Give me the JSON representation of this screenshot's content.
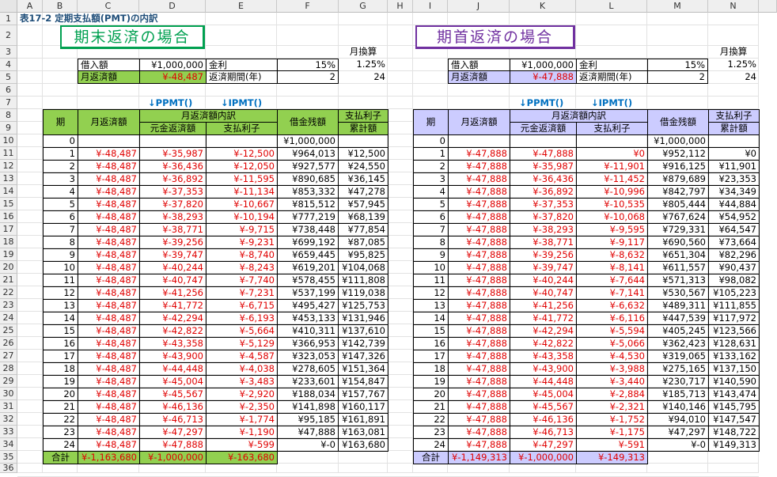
{
  "columns": [
    "A",
    "B",
    "C",
    "D",
    "E",
    "F",
    "G",
    "H",
    "I",
    "J",
    "K",
    "L",
    "M",
    "N"
  ],
  "rows": [
    "1",
    "2",
    "3",
    "4",
    "5",
    "6",
    "7",
    "8",
    "9",
    "10",
    "11",
    "12",
    "13",
    "14",
    "15",
    "16",
    "17",
    "18",
    "19",
    "20",
    "21",
    "22",
    "23",
    "24",
    "25",
    "26",
    "27",
    "28",
    "29",
    "30",
    "31",
    "32",
    "33",
    "34",
    "35",
    "36"
  ],
  "sheet_title": "表17-2 定期支払額(PMT)の内訳",
  "colors": {
    "green_header": "#92d050",
    "purple_header": "#ccccff",
    "negative": "#e00000",
    "arrow": "#0070c0"
  },
  "left": {
    "banner": "期末返済の場合",
    "monthly_label": "月換算",
    "loan_label": "借入額",
    "loan_value": "¥1,000,000",
    "rate_label": "金利",
    "rate_value": "15%",
    "rate_monthly": "1.25%",
    "payment_label": "月返済額",
    "payment_value": "¥-48,487",
    "period_label": "返済期間(年)",
    "period_value": "2",
    "period_months": "24",
    "ppmt_label": "↓PPMT()",
    "ipmt_label": "↓IPMT()",
    "headers": {
      "period": "期",
      "payment": "月返済額",
      "breakdown": "月返済額内訳",
      "principal": "元金返済額",
      "interest": "支払利子",
      "balance": "借金残額",
      "cum_interest_1": "支払利子",
      "cum_interest_2": "累計額"
    },
    "rows": [
      [
        "0",
        "",
        "",
        "",
        "¥1,000,000",
        ""
      ],
      [
        "1",
        "¥-48,487",
        "¥-35,987",
        "¥-12,500",
        "¥964,013",
        "¥12,500"
      ],
      [
        "2",
        "¥-48,487",
        "¥-36,436",
        "¥-12,050",
        "¥927,577",
        "¥24,550"
      ],
      [
        "3",
        "¥-48,487",
        "¥-36,892",
        "¥-11,595",
        "¥890,685",
        "¥36,145"
      ],
      [
        "4",
        "¥-48,487",
        "¥-37,353",
        "¥-11,134",
        "¥853,332",
        "¥47,278"
      ],
      [
        "5",
        "¥-48,487",
        "¥-37,820",
        "¥-10,667",
        "¥815,512",
        "¥57,945"
      ],
      [
        "6",
        "¥-48,487",
        "¥-38,293",
        "¥-10,194",
        "¥777,219",
        "¥68,139"
      ],
      [
        "7",
        "¥-48,487",
        "¥-38,771",
        "¥-9,715",
        "¥738,448",
        "¥77,854"
      ],
      [
        "8",
        "¥-48,487",
        "¥-39,256",
        "¥-9,231",
        "¥699,192",
        "¥87,085"
      ],
      [
        "9",
        "¥-48,487",
        "¥-39,747",
        "¥-8,740",
        "¥659,445",
        "¥95,825"
      ],
      [
        "10",
        "¥-48,487",
        "¥-40,244",
        "¥-8,243",
        "¥619,201",
        "¥104,068"
      ],
      [
        "11",
        "¥-48,487",
        "¥-40,747",
        "¥-7,740",
        "¥578,455",
        "¥111,808"
      ],
      [
        "12",
        "¥-48,487",
        "¥-41,256",
        "¥-7,231",
        "¥537,199",
        "¥119,038"
      ],
      [
        "13",
        "¥-48,487",
        "¥-41,772",
        "¥-6,715",
        "¥495,427",
        "¥125,753"
      ],
      [
        "14",
        "¥-48,487",
        "¥-42,294",
        "¥-6,193",
        "¥453,133",
        "¥131,946"
      ],
      [
        "15",
        "¥-48,487",
        "¥-42,822",
        "¥-5,664",
        "¥410,311",
        "¥137,610"
      ],
      [
        "16",
        "¥-48,487",
        "¥-43,358",
        "¥-5,129",
        "¥366,953",
        "¥142,739"
      ],
      [
        "17",
        "¥-48,487",
        "¥-43,900",
        "¥-4,587",
        "¥323,053",
        "¥147,326"
      ],
      [
        "18",
        "¥-48,487",
        "¥-44,448",
        "¥-4,038",
        "¥278,605",
        "¥151,364"
      ],
      [
        "19",
        "¥-48,487",
        "¥-45,004",
        "¥-3,483",
        "¥233,601",
        "¥154,847"
      ],
      [
        "20",
        "¥-48,487",
        "¥-45,567",
        "¥-2,920",
        "¥188,034",
        "¥157,767"
      ],
      [
        "21",
        "¥-48,487",
        "¥-46,136",
        "¥-2,350",
        "¥141,898",
        "¥160,117"
      ],
      [
        "22",
        "¥-48,487",
        "¥-46,713",
        "¥-1,774",
        "¥95,185",
        "¥161,891"
      ],
      [
        "23",
        "¥-48,487",
        "¥-47,297",
        "¥-1,190",
        "¥47,888",
        "¥163,081"
      ],
      [
        "24",
        "¥-48,487",
        "¥-47,888",
        "¥-599",
        "¥-0",
        "¥163,680"
      ]
    ],
    "total_label": "合計",
    "total_payment": "¥-1,163,680",
    "total_principal": "¥-1,000,000",
    "total_interest": "¥-163,680"
  },
  "right": {
    "banner": "期首返済の場合",
    "monthly_label": "月換算",
    "loan_label": "借入額",
    "loan_value": "¥1,000,000",
    "rate_label": "金利",
    "rate_value": "15%",
    "rate_monthly": "1.25%",
    "payment_label": "月返済額",
    "payment_value": "¥-47,888",
    "period_label": "返済期間(年)",
    "period_value": "2",
    "period_months": "24",
    "ppmt_label": "↓PPMT()",
    "ipmt_label": "↓IPMT()",
    "headers": {
      "period": "期",
      "payment": "月返済額",
      "breakdown": "月返済額内訳",
      "principal": "元金返済額",
      "interest": "支払利子",
      "balance": "借金残額",
      "cum_interest_1": "支払利子",
      "cum_interest_2": "累計額"
    },
    "rows": [
      [
        "0",
        "",
        "",
        "",
        "¥1,000,000",
        ""
      ],
      [
        "1",
        "¥-47,888",
        "¥-47,888",
        "¥0",
        "¥952,112",
        "¥0"
      ],
      [
        "2",
        "¥-47,888",
        "¥-35,987",
        "¥-11,901",
        "¥916,125",
        "¥11,901"
      ],
      [
        "3",
        "¥-47,888",
        "¥-36,436",
        "¥-11,452",
        "¥879,689",
        "¥23,353"
      ],
      [
        "4",
        "¥-47,888",
        "¥-36,892",
        "¥-10,996",
        "¥842,797",
        "¥34,349"
      ],
      [
        "5",
        "¥-47,888",
        "¥-37,353",
        "¥-10,535",
        "¥805,444",
        "¥44,884"
      ],
      [
        "6",
        "¥-47,888",
        "¥-37,820",
        "¥-10,068",
        "¥767,624",
        "¥54,952"
      ],
      [
        "7",
        "¥-47,888",
        "¥-38,293",
        "¥-9,595",
        "¥729,331",
        "¥64,547"
      ],
      [
        "8",
        "¥-47,888",
        "¥-38,771",
        "¥-9,117",
        "¥690,560",
        "¥73,664"
      ],
      [
        "9",
        "¥-47,888",
        "¥-39,256",
        "¥-8,632",
        "¥651,304",
        "¥82,296"
      ],
      [
        "10",
        "¥-47,888",
        "¥-39,747",
        "¥-8,141",
        "¥611,557",
        "¥90,437"
      ],
      [
        "11",
        "¥-47,888",
        "¥-40,244",
        "¥-7,644",
        "¥571,313",
        "¥98,082"
      ],
      [
        "12",
        "¥-47,888",
        "¥-40,747",
        "¥-7,141",
        "¥530,567",
        "¥105,223"
      ],
      [
        "13",
        "¥-47,888",
        "¥-41,256",
        "¥-6,632",
        "¥489,311",
        "¥111,855"
      ],
      [
        "14",
        "¥-47,888",
        "¥-41,772",
        "¥-6,116",
        "¥447,539",
        "¥117,972"
      ],
      [
        "15",
        "¥-47,888",
        "¥-42,294",
        "¥-5,594",
        "¥405,245",
        "¥123,566"
      ],
      [
        "16",
        "¥-47,888",
        "¥-42,822",
        "¥-5,066",
        "¥362,423",
        "¥128,631"
      ],
      [
        "17",
        "¥-47,888",
        "¥-43,358",
        "¥-4,530",
        "¥319,065",
        "¥133,162"
      ],
      [
        "18",
        "¥-47,888",
        "¥-43,900",
        "¥-3,988",
        "¥275,165",
        "¥137,150"
      ],
      [
        "19",
        "¥-47,888",
        "¥-44,448",
        "¥-3,440",
        "¥230,717",
        "¥140,590"
      ],
      [
        "20",
        "¥-47,888",
        "¥-45,004",
        "¥-2,884",
        "¥185,713",
        "¥143,474"
      ],
      [
        "21",
        "¥-47,888",
        "¥-45,567",
        "¥-2,321",
        "¥140,146",
        "¥145,795"
      ],
      [
        "22",
        "¥-47,888",
        "¥-46,136",
        "¥-1,752",
        "¥94,010",
        "¥147,547"
      ],
      [
        "23",
        "¥-47,888",
        "¥-46,713",
        "¥-1,175",
        "¥47,297",
        "¥148,722"
      ],
      [
        "24",
        "¥-47,888",
        "¥-47,297",
        "¥-591",
        "¥-0",
        "¥149,313"
      ]
    ],
    "total_label": "合計",
    "total_payment": "¥-1,149,313",
    "total_principal": "¥-1,000,000",
    "total_interest": "¥-149,313"
  }
}
